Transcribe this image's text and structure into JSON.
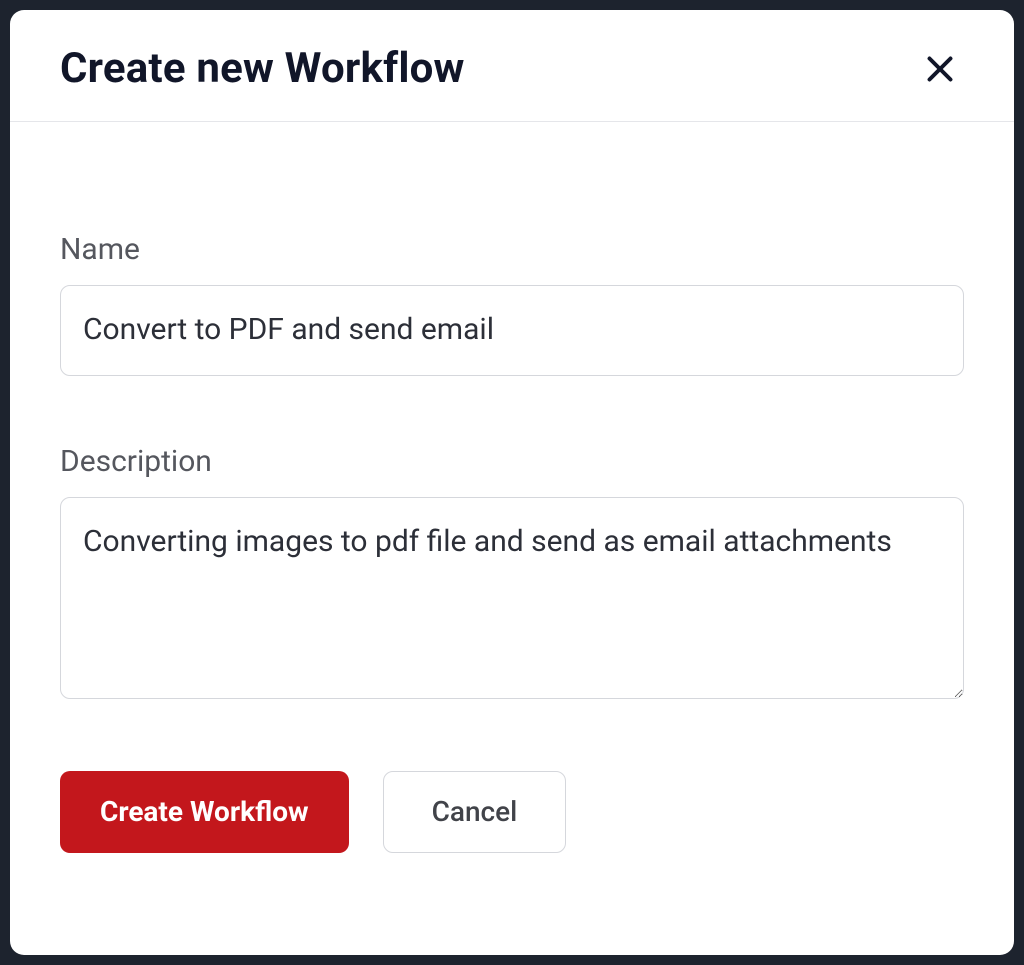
{
  "dialog": {
    "title": "Create new Workflow",
    "close_icon": "close"
  },
  "form": {
    "name_label": "Name",
    "name_value": "Convert to PDF and send email",
    "description_label": "Description",
    "description_value": "Converting images to pdf file and send as email attachments"
  },
  "buttons": {
    "create": "Create Workflow",
    "cancel": "Cancel"
  },
  "colors": {
    "primary": "#c3171c",
    "text_dark": "#111629",
    "text_muted": "#55575e",
    "border": "#d5d7dc"
  }
}
